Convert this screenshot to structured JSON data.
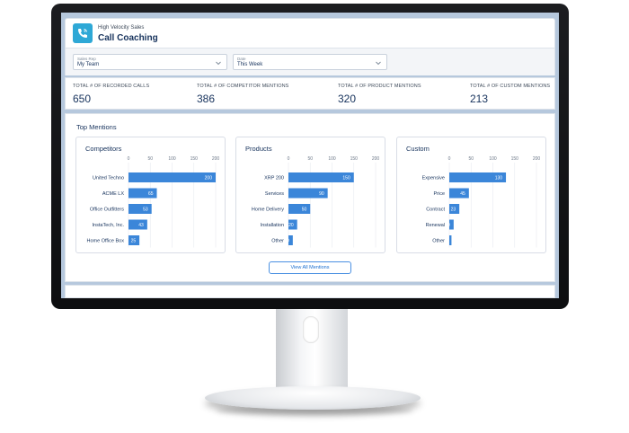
{
  "header": {
    "subtitle": "High Velocity Sales",
    "title": "Call Coaching"
  },
  "filters": [
    {
      "label": "Sales Rep",
      "value": "My Team"
    },
    {
      "label": "Date",
      "value": "This Week"
    }
  ],
  "stats": [
    {
      "label": "TOTAL # OF RECORDED CALLS",
      "value": "650"
    },
    {
      "label": "TOTAL # OF COMPETITOR MENTIONS",
      "value": "386"
    },
    {
      "label": "TOTAL # OF PRODUCT MENTIONS",
      "value": "320"
    },
    {
      "label": "TOTAL # OF CUSTOM MENTIONS",
      "value": "213"
    }
  ],
  "mentions": {
    "title": "Top Mentions",
    "view_all_label": "View All Mentions"
  },
  "colors": {
    "bar": "#3b86d9",
    "accent": "#2ea8d6",
    "link": "#1b6fd0"
  },
  "icons": {
    "app": "phone-wave-icon",
    "select": "chevron-down-icon"
  },
  "chart_data": [
    {
      "type": "bar",
      "orientation": "horizontal",
      "title": "Competitors",
      "categories": [
        "United Techno",
        "ACME LX",
        "Office Outfitters",
        "InstaTech, Inc.",
        "Home Office Box"
      ],
      "values": [
        200,
        65,
        53,
        43,
        25
      ],
      "xticks": [
        0,
        50,
        100,
        150,
        200
      ],
      "xlim": [
        0,
        200
      ]
    },
    {
      "type": "bar",
      "orientation": "horizontal",
      "title": "Products",
      "categories": [
        "XRP 200",
        "Services",
        "Home Delivery",
        "Installation",
        "Other"
      ],
      "values": [
        150,
        90,
        50,
        20,
        10
      ],
      "xticks": [
        0,
        50,
        100,
        150,
        200
      ],
      "xlim": [
        0,
        200
      ]
    },
    {
      "type": "bar",
      "orientation": "horizontal",
      "title": "Custom",
      "categories": [
        "Expensive",
        "Price",
        "Contract",
        "Renewal",
        "Other"
      ],
      "values": [
        130,
        45,
        23,
        10,
        5
      ],
      "xticks": [
        0,
        50,
        100,
        150,
        200
      ],
      "xlim": [
        0,
        200
      ]
    }
  ]
}
